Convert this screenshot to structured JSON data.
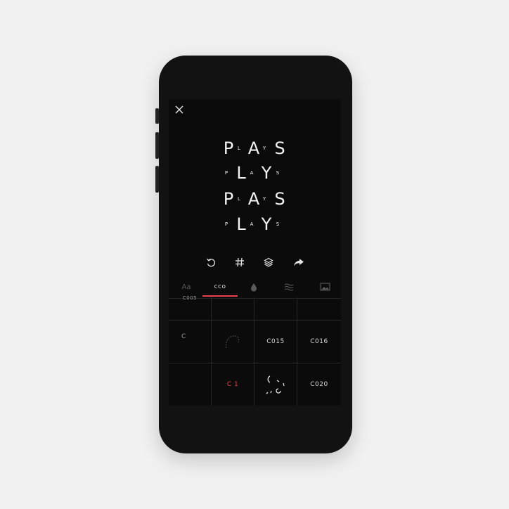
{
  "artwork": {
    "rows": [
      {
        "big1": "P",
        "small1": "L",
        "big2": "A",
        "small2": "Y",
        "big3": "S"
      },
      {
        "small1": "P",
        "big1": "L",
        "small2": "A",
        "big2": "Y",
        "small3": "S"
      },
      {
        "big1": "P",
        "small1": "L",
        "big2": "A",
        "small2": "Y",
        "big3": "S"
      },
      {
        "small1": "P",
        "big1": "L",
        "small2": "A",
        "big2": "Y",
        "small3": "S"
      }
    ]
  },
  "icons": {
    "close": "close-icon",
    "undo": "undo-icon",
    "grid": "hash-icon",
    "layers": "layers-icon",
    "share": "share-icon",
    "color": "drop-icon",
    "texture": "waves-icon",
    "image": "image-icon"
  },
  "tabs": [
    {
      "label": "Aa",
      "active": false
    },
    {
      "label": "cco",
      "active": true
    },
    {
      "label": "",
      "active": false
    },
    {
      "label": "",
      "active": false
    },
    {
      "label": "",
      "active": false
    }
  ],
  "grid": {
    "row0": [
      "C005",
      "",
      "",
      ""
    ],
    "row1": [
      "C",
      "",
      "C015",
      "C016"
    ],
    "row2": [
      "",
      "C 1",
      "",
      "C020"
    ]
  },
  "colors": {
    "accent": "#e8424a",
    "screen_bg": "#0b0b0b",
    "text": "#f4f4f4"
  }
}
